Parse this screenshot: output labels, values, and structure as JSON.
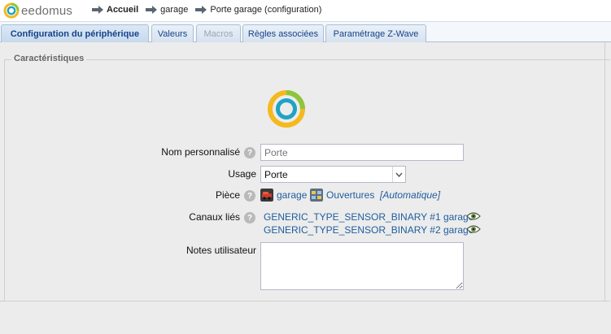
{
  "app": {
    "logo_text": "eedomus"
  },
  "breadcrumb": [
    {
      "label": "Accueil"
    },
    {
      "label": "garage"
    },
    {
      "label": "Porte garage (configuration)"
    }
  ],
  "tabs": [
    {
      "label": "Configuration du périphérique",
      "state": "active"
    },
    {
      "label": "Valeurs",
      "state": "normal"
    },
    {
      "label": "Macros",
      "state": "disabled"
    },
    {
      "label": "Règles associées",
      "state": "normal"
    },
    {
      "label": "Paramétrage Z-Wave",
      "state": "normal"
    }
  ],
  "section": {
    "legend": "Caractéristiques"
  },
  "form": {
    "custom_name_label": "Nom personnalisé",
    "custom_name_placeholder": "Porte",
    "usage_label": "Usage",
    "usage_value": "Porte",
    "room_label": "Pièce",
    "room_name": "garage",
    "room_group": "Ouvertures",
    "room_auto": "[Automatique]",
    "channels_label": "Canaux liés",
    "channels": [
      "GENERIC_TYPE_SENSOR_BINARY #1 garage",
      "GENERIC_TYPE_SENSOR_BINARY #2 garage"
    ],
    "notes_label": "Notes utilisateur",
    "notes_value": ""
  },
  "icons": {
    "help": "?",
    "breadcrumb_arrow": "right-arrow-icon",
    "eye": "eye-icon",
    "dropdown": "chevron-down-icon",
    "room_garage": "garage-room-icon",
    "room_openings": "openings-group-icon"
  },
  "colors": {
    "accent_blue": "#15428b",
    "link_blue": "#1f5c9e",
    "logo_green": "#8cc63f",
    "logo_yellow": "#f5b91d",
    "logo_teal": "#1fa3c4"
  }
}
